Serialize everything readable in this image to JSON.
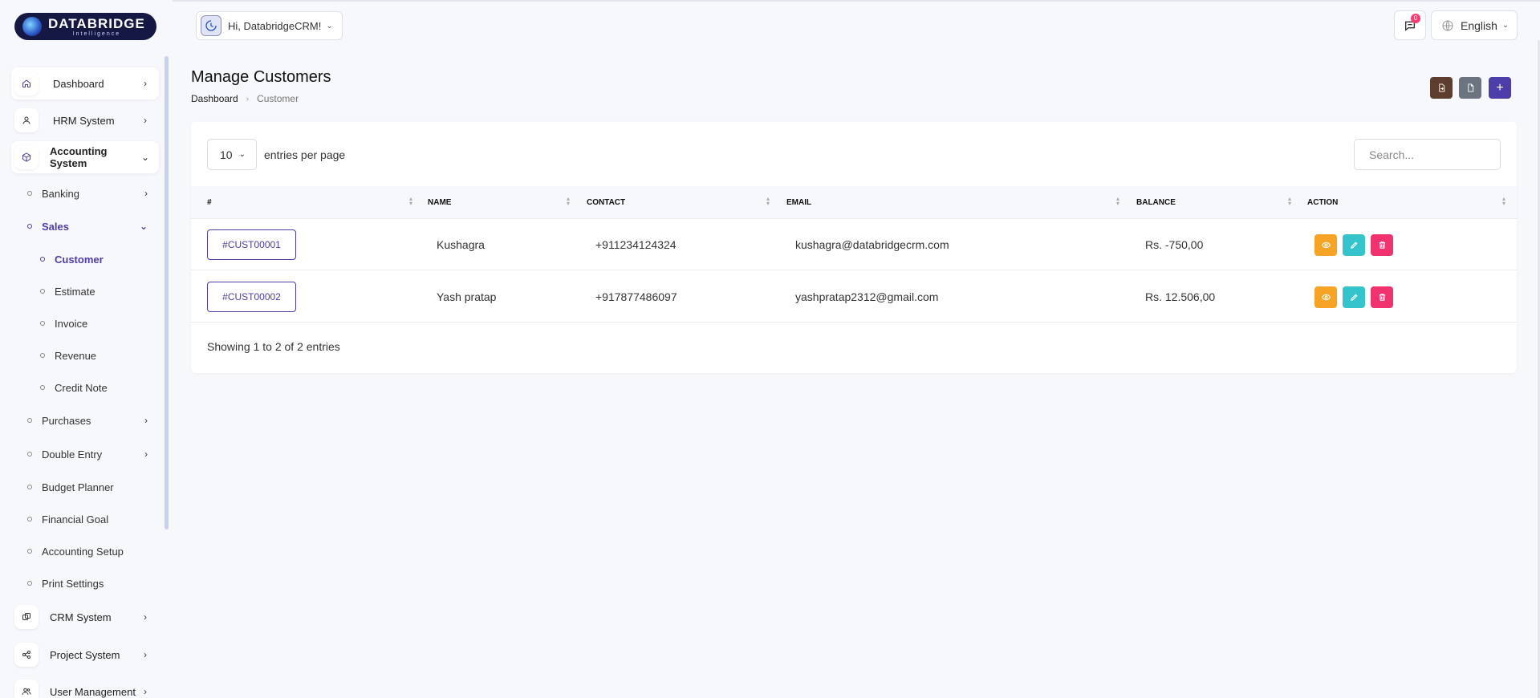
{
  "brand": {
    "name": "DATABRIDGE",
    "tagline": "Intelligence"
  },
  "sidebar": {
    "items": [
      {
        "label": "Dashboard",
        "icon": "home-icon"
      },
      {
        "label": "HRM System",
        "icon": "user-icon"
      },
      {
        "label": "Accounting System",
        "icon": "box-icon"
      },
      {
        "label": "CRM System",
        "icon": "layers-icon"
      },
      {
        "label": "Project System",
        "icon": "share-icon"
      },
      {
        "label": "User Management",
        "icon": "users-icon"
      }
    ],
    "accounting_sub": [
      {
        "label": "Banking"
      },
      {
        "label": "Sales"
      },
      {
        "label": "Purchases"
      },
      {
        "label": "Double Entry"
      },
      {
        "label": "Budget Planner"
      },
      {
        "label": "Financial Goal"
      },
      {
        "label": "Accounting Setup"
      },
      {
        "label": "Print Settings"
      }
    ],
    "sales_sub": [
      {
        "label": "Customer"
      },
      {
        "label": "Estimate"
      },
      {
        "label": "Invoice"
      },
      {
        "label": "Revenue"
      },
      {
        "label": "Credit Note"
      }
    ]
  },
  "header": {
    "greeting": "Hi, DatabridgeCRM!",
    "notification_count": "0",
    "language": "English"
  },
  "page": {
    "title": "Manage Customers",
    "breadcrumb": [
      "Dashboard",
      "Customer"
    ]
  },
  "colors": {
    "accent": "#4b3ea8",
    "export": "#5c3d2e",
    "import": "#6c7480",
    "view": "#f7a325",
    "edit": "#36c4cc",
    "delete": "#f0326e"
  },
  "table": {
    "per_page_value": "10",
    "per_page_label": "entries per page",
    "search_placeholder": "Search...",
    "columns": [
      "#",
      "NAME",
      "CONTACT",
      "EMAIL",
      "BALANCE",
      "ACTION"
    ],
    "rows": [
      {
        "id": "#CUST00001",
        "name": "Kushagra",
        "contact": "+911234124324",
        "email": "kushagra@databridgecrm.com",
        "balance": "Rs. -750,00"
      },
      {
        "id": "#CUST00002",
        "name": "Yash pratap",
        "contact": "+917877486097",
        "email": "yashpratap2312@gmail.com",
        "balance": "Rs. 12.506,00"
      }
    ],
    "showing": "Showing 1 to 2 of 2 entries"
  }
}
